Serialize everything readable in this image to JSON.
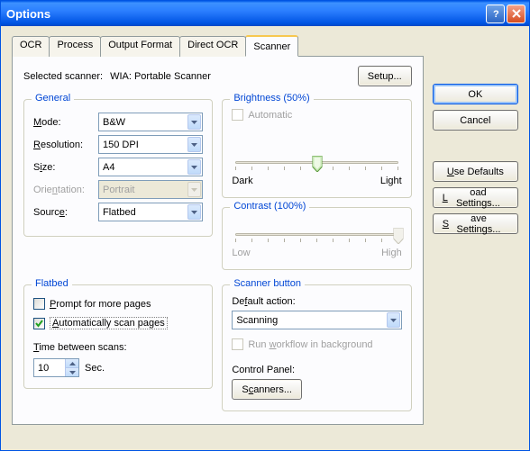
{
  "window": {
    "title": "Options"
  },
  "tabs": [
    "OCR",
    "Process",
    "Output Format",
    "Direct OCR",
    "Scanner"
  ],
  "active_tab": 4,
  "selected_scanner_label": "Selected scanner:",
  "selected_scanner": "WIA: Portable Scanner",
  "setup_button": "Setup...",
  "general": {
    "title": "General",
    "mode_label": "Mode:",
    "mode_value": "B&W",
    "resolution_label": "Resolution:",
    "resolution_value": "150 DPI",
    "size_label": "Size:",
    "size_value": "A4",
    "orientation_label": "Orientation:",
    "orientation_value": "Portrait",
    "source_label": "Source:",
    "source_value": "Flatbed"
  },
  "brightness": {
    "title": "Brightness (50%)",
    "auto": "Automatic",
    "dark": "Dark",
    "light": "Light",
    "value": 50
  },
  "contrast": {
    "title": "Contrast (100%)",
    "low": "Low",
    "high": "High",
    "value": 100
  },
  "flatbed": {
    "title": "Flatbed",
    "prompt": "Prompt for more pages",
    "auto": "Automatically scan pages",
    "time_label": "Time between scans:",
    "time_value": "10",
    "sec": "Sec."
  },
  "scanner_button": {
    "title": "Scanner button",
    "default_action_label": "Default action:",
    "default_action_value": "Scanning",
    "run_wf": "Run workflow in background",
    "cp_label": "Control Panel:",
    "scanners_btn": "Scanners..."
  },
  "buttons": {
    "ok": "OK",
    "cancel": "Cancel",
    "use_defaults": "Use Defaults",
    "load": "Load Settings...",
    "save": "Save Settings..."
  }
}
